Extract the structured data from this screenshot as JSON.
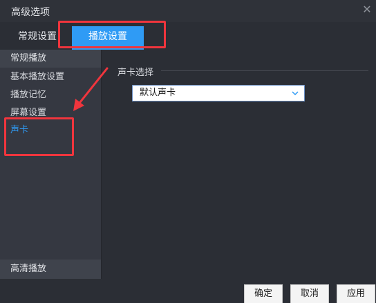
{
  "window": {
    "title": "高级选项",
    "close_glyph": "✕"
  },
  "tabs": [
    {
      "label": "常规设置",
      "active": false
    },
    {
      "label": "播放设置",
      "active": true
    }
  ],
  "sidebar": {
    "header": "常规播放",
    "items": [
      {
        "label": "基本播放设置",
        "active": false
      },
      {
        "label": "播放记忆",
        "active": false
      },
      {
        "label": "屏幕设置",
        "active": false
      },
      {
        "label": "声卡",
        "active": true
      }
    ],
    "footer": "高清播放"
  },
  "content": {
    "section_label": "声卡选择",
    "sound_card_select": {
      "value": "默认声卡",
      "icon": "chevron-down-icon"
    }
  },
  "buttons": {
    "ok": "确定",
    "cancel": "取消",
    "apply": "应用"
  },
  "colors": {
    "accent": "#2f9bf5",
    "highlight_annotation": "#f0353d",
    "background": "#2b2e35",
    "sidebar": "#353841"
  }
}
